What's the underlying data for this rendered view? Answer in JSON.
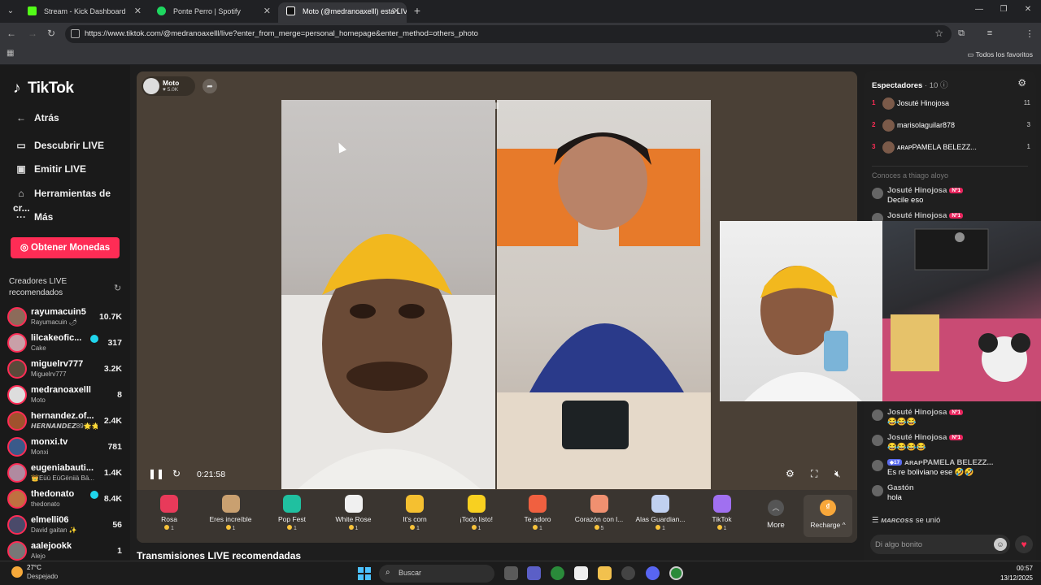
{
  "browser": {
    "tabs": [
      {
        "title": "Stream - Kick Dashboard",
        "color": "#53fc18"
      },
      {
        "title": "Ponte Perro | Spotify",
        "color": "#1ed760"
      },
      {
        "title": "Moto (@medranoaxelll) está LIVE",
        "color": "#ffffff"
      }
    ],
    "url": "https://www.tiktok.com/@medranoaxelll/live?enter_from_merge=personal_homepage&enter_method=others_photo",
    "bookmarks_label": "Todos los favoritos"
  },
  "nav": {
    "logo": "TikTok",
    "back": "Atrás",
    "items": [
      "Descubrir LIVE",
      "Emitir LIVE",
      "Herramientas de cr...",
      "Más"
    ],
    "coins_button": "Obtener Monedas",
    "recommended_title": "Creadores LIVE recomendados",
    "creators": [
      {
        "name": "rayumacuin5",
        "sub": "Rayumacuin 🌶",
        "count": "10.7K",
        "color": "#8c6b5a"
      },
      {
        "name": "lilcakeofic...",
        "sub": "Cake",
        "count": "317",
        "color": "#c9a0a8",
        "verified": true
      },
      {
        "name": "miguelrv777",
        "sub": "Miguelrv777",
        "count": "3.2K",
        "color": "#5a4a3a"
      },
      {
        "name": "medranoaxelll",
        "sub": "Moto",
        "count": "8",
        "color": "#ddd"
      },
      {
        "name": "hernandez.of...",
        "sub": "𝙃𝙀𝙍𝙉𝘼𝙉𝘿𝙀𝙕89🌟🌟",
        "count": "2.4K",
        "color": "#a0522d"
      },
      {
        "name": "monxi.tv",
        "sub": "Monxi",
        "count": "781",
        "color": "#3a5a8a"
      },
      {
        "name": "eugeniabauti...",
        "sub": "👑Eüü EüGëniiä Bä...",
        "count": "1.4K",
        "color": "#b08aa0"
      },
      {
        "name": "thedonato",
        "sub": "thedonato",
        "count": "8.4K",
        "color": "#c07040",
        "verified": true
      },
      {
        "name": "elmelli06",
        "sub": "David gaitan ✨",
        "count": "56",
        "color": "#4a4a6a"
      },
      {
        "name": "aalejookk",
        "sub": "Alejo",
        "count": "1",
        "color": "#777"
      }
    ]
  },
  "player": {
    "host_name": "Moto",
    "host_likes": "♥ 5.0K",
    "timer": "0:21:58",
    "gifts": [
      {
        "name": "Rosa",
        "price": "1",
        "color": "#e83a5a"
      },
      {
        "name": "Eres increíble",
        "price": "1",
        "color": "#c9a070"
      },
      {
        "name": "Pop Fest",
        "price": "1",
        "color": "#20c0a0"
      },
      {
        "name": "White Rose",
        "price": "1",
        "color": "#f0f0f0"
      },
      {
        "name": "It's corn",
        "price": "1",
        "color": "#f5c030"
      },
      {
        "name": "¡Todo listo!",
        "price": "1",
        "color": "#f8d020"
      },
      {
        "name": "Te adoro",
        "price": "1",
        "color": "#f06040"
      },
      {
        "name": "Corazón con l...",
        "price": "5",
        "color": "#f09070"
      },
      {
        "name": "Alas Guardian...",
        "price": "1",
        "color": "#c0d0f0"
      },
      {
        "name": "TikTok",
        "price": "1",
        "color": "#a070f0"
      }
    ],
    "more_label": "More",
    "recharge_label": "Recharge"
  },
  "section_title": "Transmisiones LIVE recomendadas",
  "chat": {
    "viewers_label": "Espectadores",
    "viewers_count": "· 10",
    "ranking": [
      {
        "rank": "1",
        "name": "Josuté Hinojosa",
        "score": "11"
      },
      {
        "rank": "2",
        "name": "marisolaguilar878",
        "score": "3"
      },
      {
        "rank": "3",
        "name": "ᴀʀᴀᴘPAMELA BELEZZ...",
        "score": "1"
      }
    ],
    "faded_text": "Conoces a thiago aloyo",
    "messages": [
      {
        "name": "Josuté Hinojosa",
        "badge": "Nº1",
        "text": "Decile eso"
      },
      {
        "name": "Josuté Hinojosa",
        "badge": "Nº1",
        "text": ""
      },
      {
        "name": "Josuté Hinojosa",
        "badge": "Nº1",
        "text": "😂😂😂"
      },
      {
        "name": "Josuté Hinojosa",
        "badge": "Nº1",
        "text": "😂😂😂😂"
      },
      {
        "name": "ᴀʀᴀᴘPAMELA BELEZZ...",
        "level": "17",
        "text": "Es re boliviano ese 🤣🤣"
      },
      {
        "name": "Gastón",
        "text": "hola"
      }
    ],
    "joined_user": "ᴍᴀʀᴄᴏss",
    "joined_text": "se unió",
    "input_placeholder": "Di algo bonito"
  },
  "taskbar": {
    "temp": "27°C",
    "weather": "Despejado",
    "search": "Buscar",
    "time": "00:57",
    "date": "13/12/2025"
  }
}
